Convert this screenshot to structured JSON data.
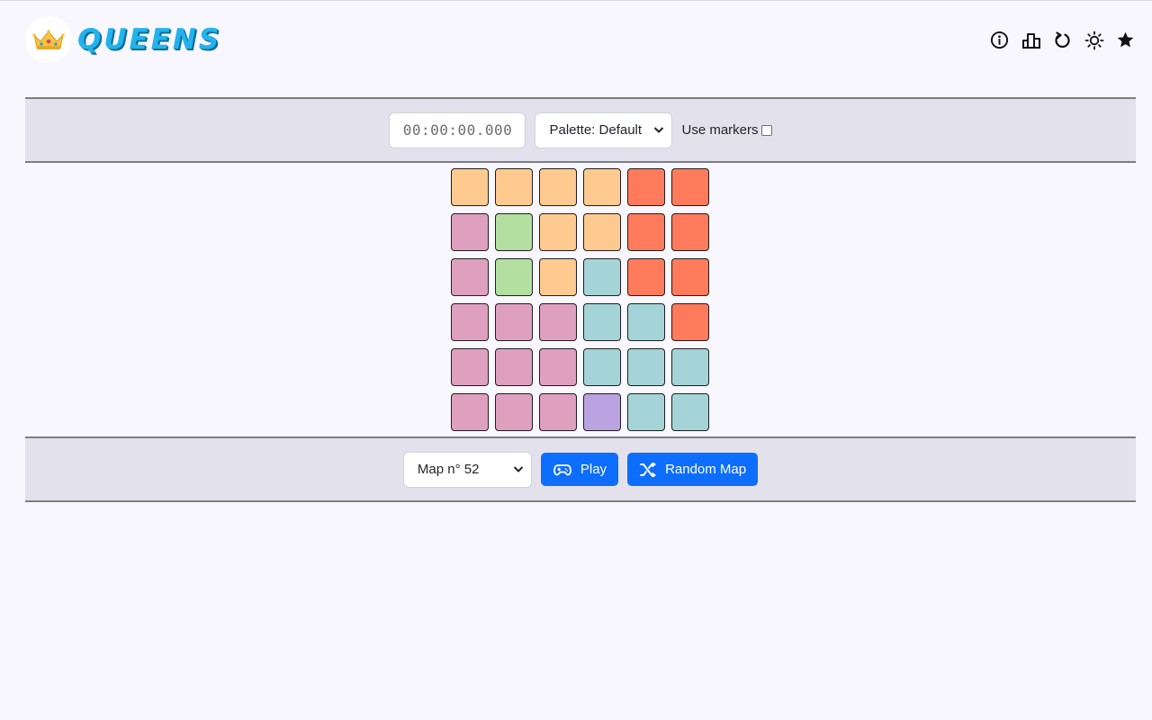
{
  "header": {
    "title": "QUEENS",
    "icons": [
      "info-icon",
      "leaderboard-icon",
      "reset-icon",
      "theme-sun-icon",
      "star-icon"
    ]
  },
  "controls": {
    "timer": "00:00:00.000",
    "palette_selected": "Palette: Default",
    "use_markers_label": "Use markers",
    "use_markers_checked": false
  },
  "footer": {
    "map_selected": "Map n° 52",
    "play_label": "Play",
    "random_label": "Random Map"
  },
  "board": {
    "size": 6,
    "colors": {
      "orange": "#ffca8f",
      "red": "#ff7b5c",
      "pink": "#dfa0c0",
      "green": "#b3e0a0",
      "teal": "#a4d4d8",
      "purple": "#bba3e2"
    },
    "regions": [
      [
        "orange",
        "orange",
        "orange",
        "orange",
        "red",
        "red"
      ],
      [
        "pink",
        "green",
        "orange",
        "orange",
        "red",
        "red"
      ],
      [
        "pink",
        "green",
        "orange",
        "teal",
        "red",
        "red"
      ],
      [
        "pink",
        "pink",
        "pink",
        "teal",
        "teal",
        "red"
      ],
      [
        "pink",
        "pink",
        "pink",
        "teal",
        "teal",
        "teal"
      ],
      [
        "pink",
        "pink",
        "pink",
        "purple",
        "teal",
        "teal"
      ]
    ]
  },
  "theme": {
    "accent": "#0d6efd",
    "title_color": "#23b3ec",
    "bar_background": "#e3e2ec"
  }
}
